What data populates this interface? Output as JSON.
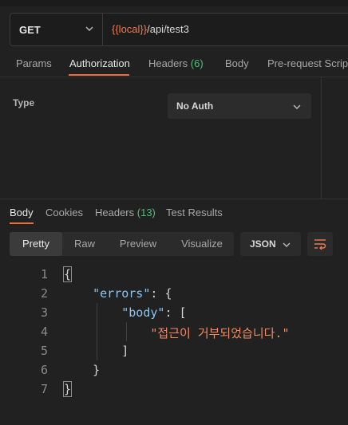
{
  "request": {
    "method": "GET",
    "url_var": "{{local}}",
    "url_path": "/api/test3"
  },
  "request_tabs": [
    {
      "label": "Params"
    },
    {
      "label": "Authorization"
    },
    {
      "label": "Headers",
      "count": "(6)"
    },
    {
      "label": "Body"
    },
    {
      "label": "Pre-request Script"
    }
  ],
  "auth": {
    "type_label": "Type",
    "selected": "No Auth"
  },
  "response_tabs": [
    {
      "label": "Body"
    },
    {
      "label": "Cookies"
    },
    {
      "label": "Headers",
      "count": "(13)"
    },
    {
      "label": "Test Results"
    }
  ],
  "view_modes": [
    {
      "label": "Pretty"
    },
    {
      "label": "Raw"
    },
    {
      "label": "Preview"
    },
    {
      "label": "Visualize"
    }
  ],
  "format": "JSON",
  "icons": {
    "method_chevron": "chevron-down-icon",
    "auth_chevron": "chevron-down-icon",
    "format_chevron": "chevron-down-icon",
    "wrap": "wrap-lines-icon"
  },
  "colors": {
    "accent": "#f26b3a",
    "variable": "#ef7a4f",
    "count": "#4fbf7a",
    "json_key": "#8dc4f0",
    "json_string": "#ef8a62"
  },
  "response_body": {
    "line_numbers": [
      "1",
      "2",
      "3",
      "4",
      "5",
      "6",
      "7"
    ],
    "open_brace": "{",
    "errors_key": "\"errors\"",
    "body_key": "\"body\"",
    "colon": ":",
    "open_brace_2": "{",
    "open_bracket": "[",
    "message": "\"접근이 거부되었습니다.\"",
    "close_bracket": "]",
    "close_brace_inner": "}",
    "close_brace": "}"
  }
}
